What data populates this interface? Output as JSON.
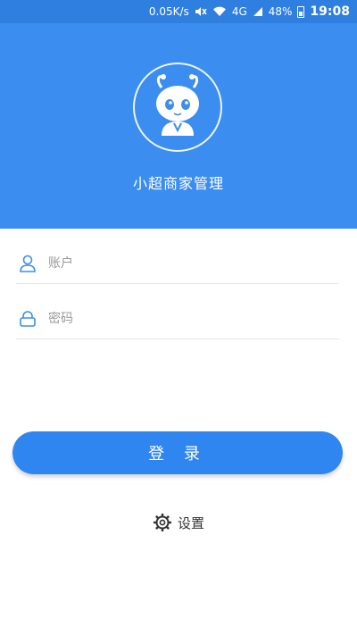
{
  "status_bar": {
    "network_speed": "0.05K/s",
    "network_type": "4G",
    "battery": "48%",
    "time": "19:08"
  },
  "header": {
    "app_title": "小超商家管理",
    "logo_icon": "robot-mascot-icon"
  },
  "form": {
    "account_placeholder": "账户",
    "password_placeholder": "密码",
    "account_icon": "user-icon",
    "password_icon": "lock-icon"
  },
  "actions": {
    "login_label": "登 录",
    "settings_label": "设置",
    "settings_icon": "gear-icon"
  },
  "colors": {
    "header_bg": "#3b8ef0",
    "button_bg": "#2f86f0",
    "icon_accent": "#3b8ef0"
  }
}
